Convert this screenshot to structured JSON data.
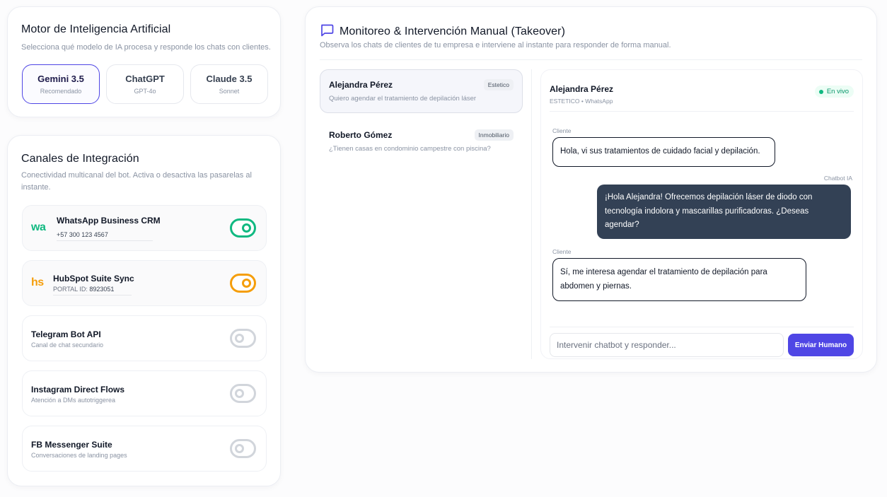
{
  "ai_engine": {
    "title": "Motor de Inteligencia Artificial",
    "subtitle": "Selecciona qué modelo de IA procesa y responde los chats con clientes.",
    "models": [
      {
        "name": "Gemini 3.5",
        "sub": "Recomendado",
        "selected": true
      },
      {
        "name": "ChatGPT",
        "sub": "GPT-4o",
        "selected": false
      },
      {
        "name": "Claude 3.5",
        "sub": "Sonnet",
        "selected": false
      }
    ]
  },
  "channels": {
    "title": "Canales de Integración",
    "subtitle": "Conectividad multicanal del bot. Activa o desactiva las pasarelas al instante.",
    "items": [
      {
        "name": "WhatsApp Business CRM",
        "logo": "wa",
        "value": "+57 300 123 4567",
        "enabled": true,
        "color": "#10b981"
      },
      {
        "name": "HubSpot Suite Sync",
        "logo": "hs",
        "value_label": "PORTAL ID:",
        "value": "8923051",
        "enabled": true,
        "color": "#f59e0b"
      },
      {
        "name": "Telegram Bot API",
        "description": "Canal de chat secundario",
        "enabled": false
      },
      {
        "name": "Instagram Direct Flows",
        "description": "Atención a DMs autotriggerea",
        "enabled": false
      },
      {
        "name": "FB Messenger Suite",
        "description": "Conversaciones de landing pages",
        "enabled": false
      }
    ]
  },
  "monitor": {
    "title": "Monitoreo & Intervención Manual (Takeover)",
    "subtitle": "Observa los chats de clientes de tu empresa e interviene al instante para responder de forma manual.",
    "icon": "chat-bubble-icon",
    "chats": [
      {
        "name": "Alejandra Pérez",
        "tag": "Estetico",
        "preview": "Quiero agendar el tratamiento de depilación láser",
        "active": true
      },
      {
        "name": "Roberto Gómez",
        "tag": "Inmobiliario",
        "preview": "¿Tienen casas en condominio campestre con piscina?",
        "active": false
      }
    ],
    "conversation": {
      "name": "Alejandra Pérez",
      "meta": "ESTETICO • WhatsApp",
      "status": "En vivo",
      "messages": [
        {
          "sender": "Cliente",
          "text": "Hola, vi sus tratamientos de cuidado facial y depilación."
        },
        {
          "sender": "Chatbot IA",
          "text": "¡Hola Alejandra! Ofrecemos depilación láser de diodo con tecnología indolora y mascarillas purificadoras. ¿Deseas agendar?"
        },
        {
          "sender": "Cliente",
          "text": "Sí, me interesa agendar el tratamiento de depilación para abdomen y piernas."
        }
      ],
      "input_placeholder": "Intervenir chatbot y responder...",
      "input_value": "",
      "send_label": "Enviar Humano"
    }
  },
  "colors": {
    "accent": "#4f46e5",
    "bot_bubble": "#334155",
    "live_green": "#10b981",
    "hubspot_orange": "#f59e0b"
  }
}
